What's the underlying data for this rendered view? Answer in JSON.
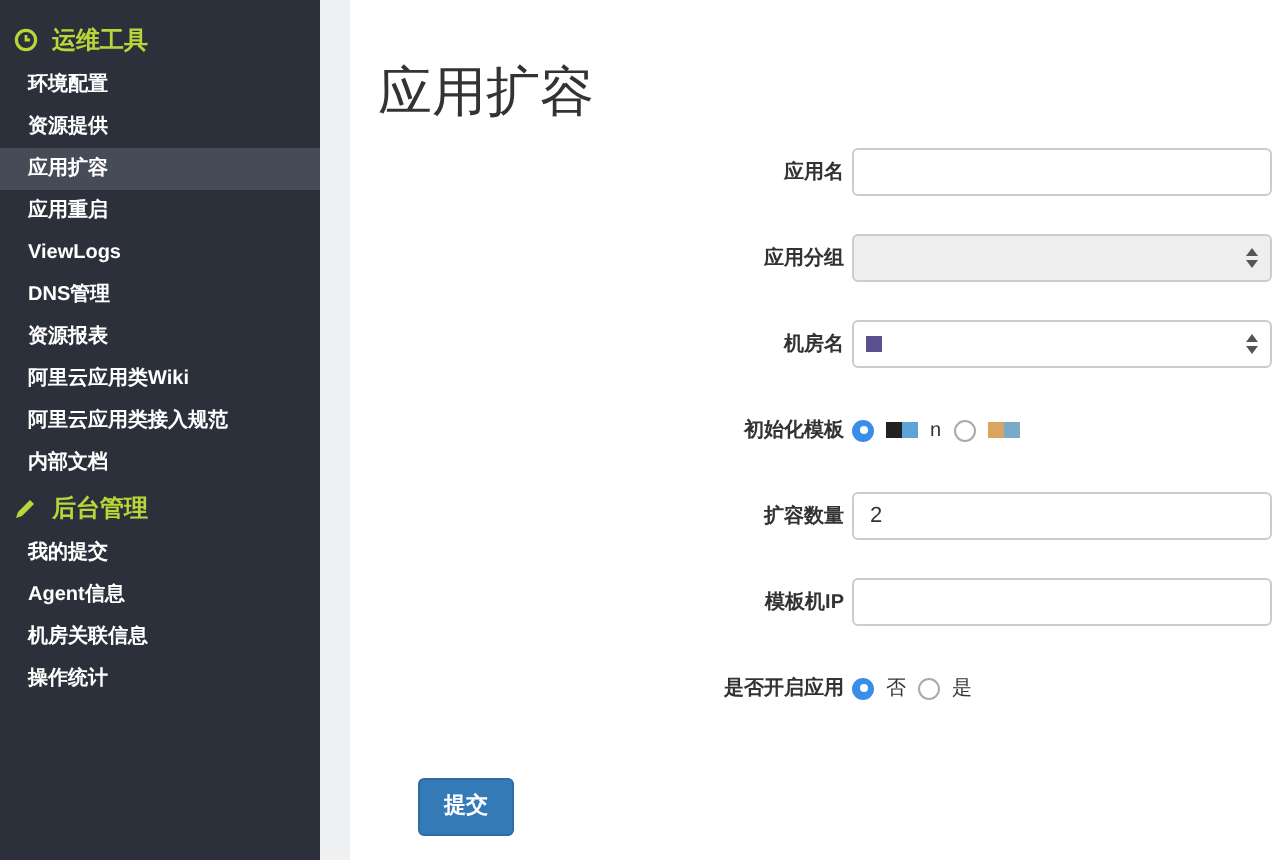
{
  "sidebar": {
    "sections": [
      {
        "title": "运维工具",
        "items": [
          {
            "label": "环境配置",
            "selected": false
          },
          {
            "label": "资源提供",
            "selected": false
          },
          {
            "label": "应用扩容",
            "selected": true
          },
          {
            "label": "应用重启",
            "selected": false
          },
          {
            "label": "ViewLogs",
            "selected": false
          },
          {
            "label": "DNS管理",
            "selected": false
          },
          {
            "label": "资源报表",
            "selected": false
          },
          {
            "label": "阿里云应用类Wiki",
            "selected": false
          },
          {
            "label": "阿里云应用类接入规范",
            "selected": false
          },
          {
            "label": "内部文档",
            "selected": false
          }
        ]
      },
      {
        "title": "后台管理",
        "items": [
          {
            "label": "我的提交",
            "selected": false
          },
          {
            "label": "Agent信息",
            "selected": false
          },
          {
            "label": "机房关联信息",
            "selected": false
          },
          {
            "label": "操作统计",
            "selected": false
          }
        ]
      }
    ]
  },
  "page_title": "应用扩容",
  "form": [
    {
      "kind": "text",
      "label": "应用名"
    },
    {
      "kind": "select",
      "label": "应用分组",
      "disabled": true
    },
    {
      "kind": "select",
      "label": "机房名",
      "disabled": false,
      "redacted": true
    },
    {
      "kind": "radio",
      "label": "初始化模板",
      "options": [
        {
          "label": "n",
          "selected": true,
          "redacted": true
        },
        {
          "selected": false,
          "redacted": true
        }
      ]
    },
    {
      "kind": "text",
      "label": "扩容数量",
      "value": "2"
    },
    {
      "kind": "text",
      "label": "模板机IP"
    },
    {
      "kind": "radio",
      "label": "是否开启应用",
      "options": [
        {
          "label": "否",
          "selected": true
        },
        {
          "label": "是",
          "selected": false
        }
      ]
    }
  ],
  "submit": "提交"
}
